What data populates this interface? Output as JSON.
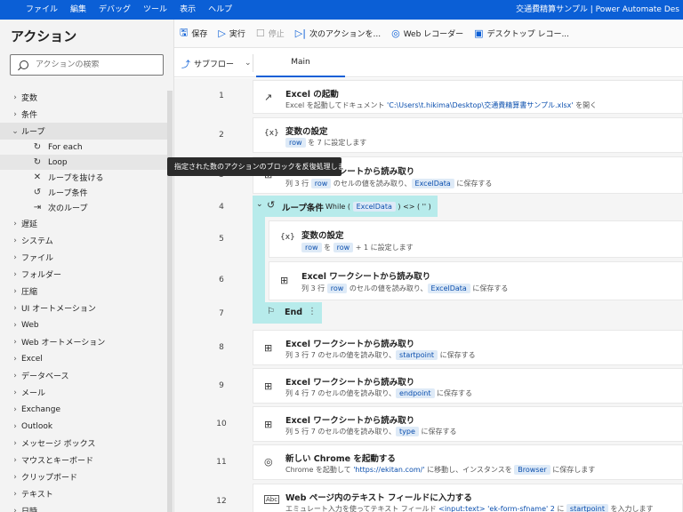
{
  "menubar": {
    "items": [
      "ファイル",
      "編集",
      "デバッグ",
      "ツール",
      "表示",
      "ヘルプ"
    ],
    "window_title": "交通費精算サンプル | Power Automate Des"
  },
  "sidebar": {
    "title": "アクション",
    "search_placeholder": "アクションの検索",
    "items_top": [
      "変数",
      "条件"
    ],
    "loop": {
      "label": "ループ",
      "children": [
        "For each",
        "Loop",
        "ループを抜ける",
        "ループ条件",
        "次のループ"
      ]
    },
    "items_bottom": [
      "遅延",
      "システム",
      "ファイル",
      "フォルダー",
      "圧縮",
      "UI オートメーション",
      "Web",
      "Web オートメーション",
      "Excel",
      "データベース",
      "メール",
      "Exchange",
      "Outlook",
      "メッセージ ボックス",
      "マウスとキーボード",
      "クリップボード",
      "テキスト",
      "日時"
    ]
  },
  "toolbar": {
    "save": "保存",
    "run": "実行",
    "stop": "停止",
    "next_action": "次のアクションを...",
    "web_recorder": "Web レコーダー",
    "desktop_recorder": "デスクトップ レコー..."
  },
  "tabs": {
    "subflow": "サブフロー",
    "main": "Main"
  },
  "tooltip": "指定された数のアクションのブロックを反復処理します",
  "flow": {
    "a1": {
      "num": "1",
      "title": "Excel の起動",
      "desc": "Excel を起動してドキュメント ",
      "path": "'C:\\Users\\t.hikima\\Desktop\\交通費精算書サンプル.xlsx'",
      "desc2": " を開く"
    },
    "a2": {
      "num": "2",
      "title": "変数の設定",
      "pill": "row",
      "desc": " を 7 に設定します"
    },
    "a3": {
      "num": "3",
      "title": "Excel ワークシートから読み取り",
      "d1": "列 3 行 ",
      "pill1": "row",
      "d2": " のセルの値を読み取り、",
      "pill2": "ExcelData",
      "d3": " に保存する"
    },
    "a4": {
      "num": "4",
      "title": "ループ条件",
      "t1": "While ( ",
      "pill1": "ExcelData",
      "t2": " ) <> ( '' )"
    },
    "a5": {
      "num": "5",
      "title": "変数の設定",
      "pill1": "row",
      "d1": " を ",
      "pill2": "row",
      "d2": " + 1 に設定します"
    },
    "a6": {
      "num": "6",
      "title": "Excel ワークシートから読み取り",
      "d1": "列 3 行 ",
      "pill1": "row",
      "d2": " のセルの値を読み取り、",
      "pill2": "ExcelData",
      "d3": " に保存する"
    },
    "a7": {
      "num": "7",
      "title": "End"
    },
    "a8": {
      "num": "8",
      "title": "Excel ワークシートから読み取り",
      "d1": "列 3 行 7 のセルの値を読み取り、",
      "pill": "startpoint",
      "d2": " に保存する"
    },
    "a9": {
      "num": "9",
      "title": "Excel ワークシートから読み取り",
      "d1": "列 4 行 7 のセルの値を読み取り、",
      "pill": "endpoint",
      "d2": " に保存する"
    },
    "a10": {
      "num": "10",
      "title": "Excel ワークシートから読み取り",
      "d1": "列 5 行 7 のセルの値を読み取り、",
      "pill": "type",
      "d2": " に保存する"
    },
    "a11": {
      "num": "11",
      "title": "新しい Chrome を起動する",
      "d1": "Chrome を起動して ",
      "url": "'https://ekitan.com/'",
      "d2": " に移動し、インスタンスを ",
      "pill": "Browser",
      "d3": " に保存します"
    },
    "a12": {
      "num": "12",
      "title": "Web ページ内のテキスト フィールドに入力する",
      "d1": "エミュレート入力を使ってテキスト フィールド ",
      "tag": "<input:text>",
      "sel": " 'ek-form-sfname' 2 ",
      "d2": "に ",
      "pill": "startpoint",
      "d3": " を入力します"
    }
  }
}
